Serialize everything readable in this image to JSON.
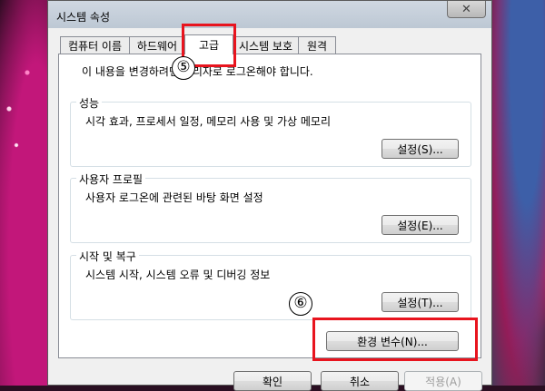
{
  "window": {
    "title": "시스템 속성",
    "close_glyph": "✕"
  },
  "tabs": [
    {
      "label": "컴퓨터 이름"
    },
    {
      "label": "하드웨어"
    },
    {
      "label": "고급"
    },
    {
      "label": "시스템 보호"
    },
    {
      "label": "원격"
    }
  ],
  "panel": {
    "note": "이 내용을 변경하려면 관리자로 로그온해야 합니다.",
    "groups": [
      {
        "title": "성능",
        "description": "시각 효과, 프로세서 일정, 메모리 사용 및 가상 메모리",
        "button": "설정(S)..."
      },
      {
        "title": "사용자 프로필",
        "description": "사용자 로그온에 관련된 바탕 화면 설정",
        "button": "설정(E)..."
      },
      {
        "title": "시작 및 복구",
        "description": "시스템 시작, 시스템 오류 및 디버깅 정보",
        "button": "설정(T)..."
      }
    ],
    "env_button": "환경 변수(N)..."
  },
  "footer": {
    "ok": "확인",
    "cancel": "취소",
    "apply": "적용(A)"
  },
  "annotations": {
    "step5": "⑤",
    "step6": "⑥",
    "marker_color": "#e8141e"
  }
}
